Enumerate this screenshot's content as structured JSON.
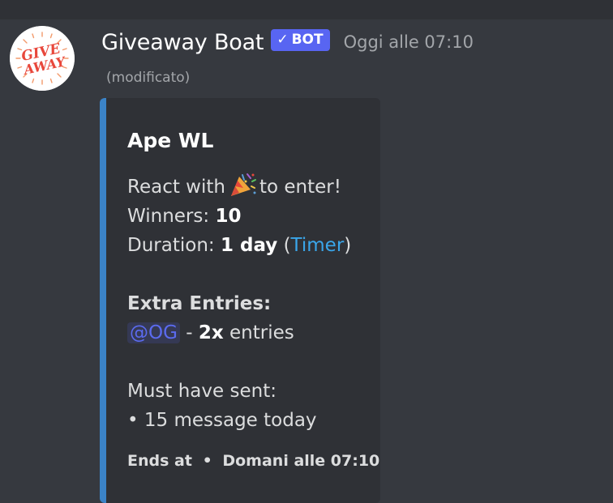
{
  "colors": {
    "background": "#36393f",
    "embed_background": "#2f3136",
    "embed_accent": "#3b83c7",
    "bot_badge": "#5865f2",
    "link": "#3aa6ea",
    "mention": "#5b6bef"
  },
  "message": {
    "avatar_icon": "giveaway-logo-icon",
    "avatar_text_line1": "GIVE",
    "avatar_text_line2": "AWAY",
    "username": "Giveaway Boat",
    "bot_badge": "BOT",
    "bot_badge_icon": "checkmark-icon",
    "timestamp": "Oggi alle 07:10",
    "edited": "(modificato)"
  },
  "embed": {
    "title": "Ape WL",
    "react_prefix": "React with",
    "react_emoji_icon": "party-popper-icon",
    "react_suffix": "to enter!",
    "winners_label": "Winners:",
    "winners_value": "10",
    "duration_label": "Duration:",
    "duration_value": "1 day",
    "duration_paren_open": "(",
    "timer_link": "Timer",
    "duration_paren_close": ")",
    "extra_entries_label": "Extra Entries:",
    "extra_role": "@OG",
    "extra_separator": "-",
    "extra_multiplier": "2x",
    "extra_suffix": "entries",
    "must_have_label": "Must have sent:",
    "requirement": "• 15 message today",
    "footer_label": "Ends at",
    "footer_separator": "•",
    "footer_time": "Domani alle 07:10"
  }
}
